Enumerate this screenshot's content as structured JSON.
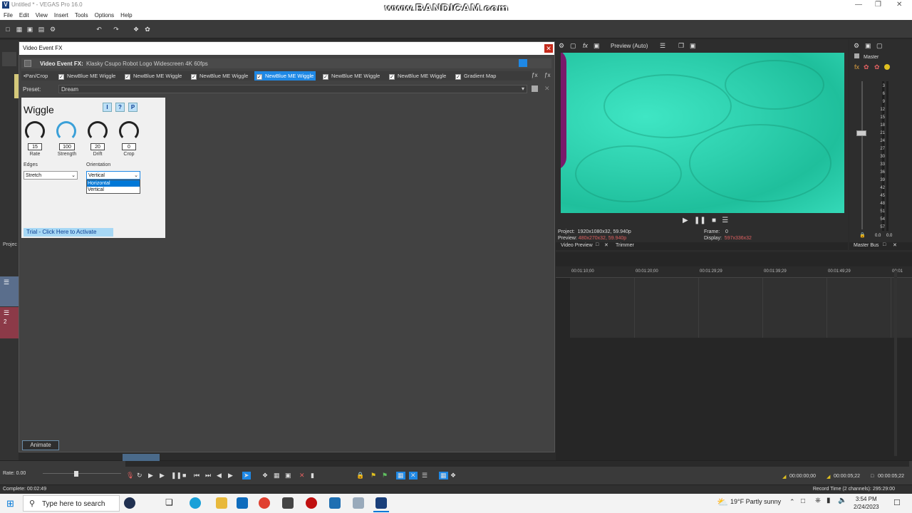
{
  "window": {
    "title": "Untitled * - VEGAS Pro 16.0",
    "app_badge": "V",
    "watermark": "www.BANDICAM.com"
  },
  "menu": [
    "File",
    "Edit",
    "View",
    "Insert",
    "Tools",
    "Options",
    "Help"
  ],
  "fx_dialog": {
    "title": "Video Event FX",
    "header_label": "Video Event FX:",
    "header_value": "Klasky Csupo Robot Logo Widescreen 4K 60fps",
    "chain": [
      {
        "label": "Pan/Crop",
        "checked": false,
        "selected": false
      },
      {
        "label": "NewBlue ME Wiggle",
        "checked": true,
        "selected": false
      },
      {
        "label": "NewBlue ME Wiggle",
        "checked": true,
        "selected": false
      },
      {
        "label": "NewBlue ME Wiggle",
        "checked": true,
        "selected": false
      },
      {
        "label": "NewBlue ME Wiggle",
        "checked": true,
        "selected": true
      },
      {
        "label": "NewBlue ME Wiggle",
        "checked": true,
        "selected": false
      },
      {
        "label": "NewBlue ME Wiggle",
        "checked": true,
        "selected": false
      },
      {
        "label": "Gradient Map",
        "checked": true,
        "selected": false
      }
    ],
    "preset_label": "Preset:",
    "preset_value": "Dream",
    "plugin": {
      "name": "Wiggle",
      "buttons": [
        "I",
        "?",
        "P"
      ],
      "knobs": [
        {
          "label": "Rate",
          "value": "15"
        },
        {
          "label": "Strength",
          "value": "100"
        },
        {
          "label": "Drift",
          "value": "20"
        },
        {
          "label": "Crop",
          "value": "0"
        }
      ],
      "edges_label": "Edges",
      "edges_value": "Stretch",
      "orientation_label": "Orientation",
      "orientation_value": "Vertical",
      "orientation_options": [
        "Horizontal",
        "Vertical"
      ],
      "trial": "Trial - Click Here to Activate"
    },
    "animate": "Animate"
  },
  "preview": {
    "mode": "Preview (Auto)",
    "project_label": "Project:",
    "project_value": "1920x1080x32, 59.940p",
    "preview_label": "Preview:",
    "preview_value": "480x270x32, 59.940p",
    "frame_label": "Frame:",
    "frame_value": "0",
    "display_label": "Display:",
    "display_value": "597x336x32",
    "tabs": [
      "Video Preview",
      "Trimmer"
    ]
  },
  "master": {
    "title": "Master",
    "tab": "Master Bus",
    "ticks": [
      "3",
      "6",
      "9",
      "12",
      "15",
      "18",
      "21",
      "24",
      "27",
      "30",
      "33",
      "36",
      "39",
      "42",
      "45",
      "48",
      "51",
      "54",
      "57"
    ],
    "readout_left": "0.0",
    "readout_right": "0.0"
  },
  "timeline": {
    "ruler": [
      "00:01:10;00",
      "00:01:20;00",
      "00:01:29;29",
      "00:01:39;29",
      "00:01:49;29",
      "00:01"
    ]
  },
  "left_dock": {
    "project_label": "Projec"
  },
  "transport": {
    "rate": "Rate: 0.00",
    "tc1": "00:00:00;00",
    "tc2": "00:00:05;22",
    "tc3": "00:00:05;22"
  },
  "status": {
    "left": "Complete: 00:02:49",
    "right": "Record Time (2 channels): 295:29:00"
  },
  "taskbar": {
    "search": "Type here to search",
    "weather": "19°F  Partly sunny",
    "time": "3:54 PM",
    "date": "2/24/2023"
  },
  "colors": {
    "accent": "#1e88e5",
    "preview": "#2ed0ae",
    "magenta": "#7a1a6a"
  }
}
